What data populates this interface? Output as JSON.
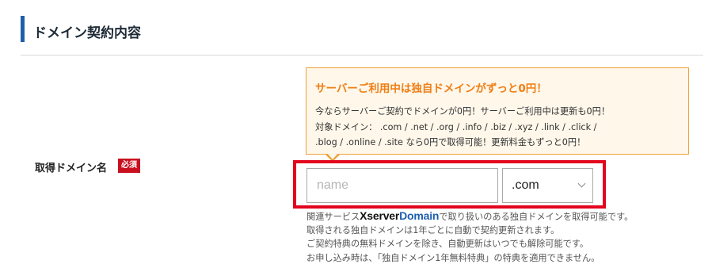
{
  "section": {
    "title": "ドメイン契約内容"
  },
  "field": {
    "label": "取得ドメイン名",
    "required_badge": "必須"
  },
  "promo": {
    "heading": "サーバーご利用中は独自ドメインがずっと0円！",
    "line1": "今ならサーバーご契約でドメインが0円！サーバーご利用中は更新も0円！",
    "line2": "対象ドメイン： .com / .net / .org / .info / .biz / .xyz / .link / .click /",
    "line3": ".blog / .online / .site なら0円で取得可能！更新料金もずっと0円！"
  },
  "domain_input": {
    "placeholder": "name",
    "value": ""
  },
  "tld_select": {
    "selected": ".com"
  },
  "notes": {
    "line1_prefix": "関連サービス",
    "logo_xserver": "Xserver",
    "logo_domain": "Domain",
    "line1_suffix": "で取り扱いのある独自ドメインを取得可能です。",
    "line2": "取得される独自ドメインは1年ごとに自動で契約更新されます。",
    "line3": "ご契約特典の無料ドメインを除き、自動更新はいつでも解除可能です。",
    "line4": "お申し込み時は、「独自ドメイン1年無料特典」の特典を適用できません。"
  },
  "colors": {
    "accent_bar": "#1f5fa8",
    "required_badge": "#c8101f",
    "promo_heading": "#ef7e14",
    "promo_border": "#f0a13a",
    "promo_bg": "#fef7ea",
    "highlight_border": "#e3051e",
    "domain_logo_blue": "#1d5fb0"
  }
}
